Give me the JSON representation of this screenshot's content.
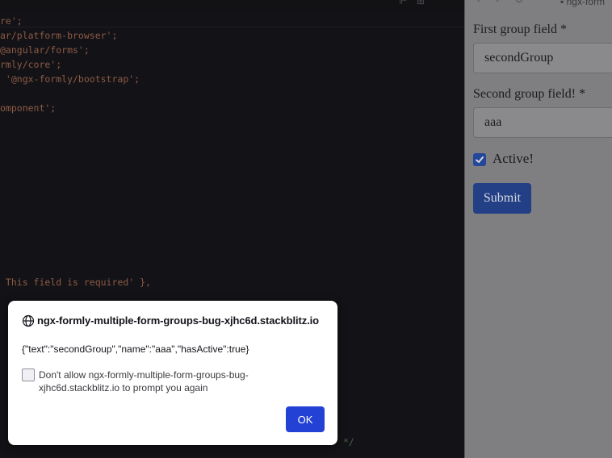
{
  "editor": {
    "code_lines": [
      "re';",
      "ar/platform-browser';",
      "@angular/forms';",
      "rmly/core';",
      " '@ngx-formly/bootstrap';",
      "omponent';",
      " This field is required' },",
      "*/"
    ]
  },
  "browser": {
    "url_fragment": "ngx-form"
  },
  "form": {
    "first_group_label": "First group field *",
    "first_group_value": "secondGroup",
    "second_group_label": "Second group field! *",
    "second_group_value": "aaa",
    "active_label": "Active!",
    "active_checked": true,
    "submit_label": "Submit"
  },
  "dialog": {
    "origin": "ngx-formly-multiple-form-groups-bug-xjhc6d.stackblitz.io",
    "message": "{\"text\":\"secondGroup\",\"name\":\"aaa\",\"hasActive\":true}",
    "suppress_label": "Don't allow ngx-formly-multiple-form-groups-bug-xjhc6d.stackblitz.io to prompt you again",
    "ok_label": "OK"
  },
  "colors": {
    "accent": "#2342d5",
    "editor_bg": "#131317",
    "preview_bg": "#7f7f81"
  }
}
